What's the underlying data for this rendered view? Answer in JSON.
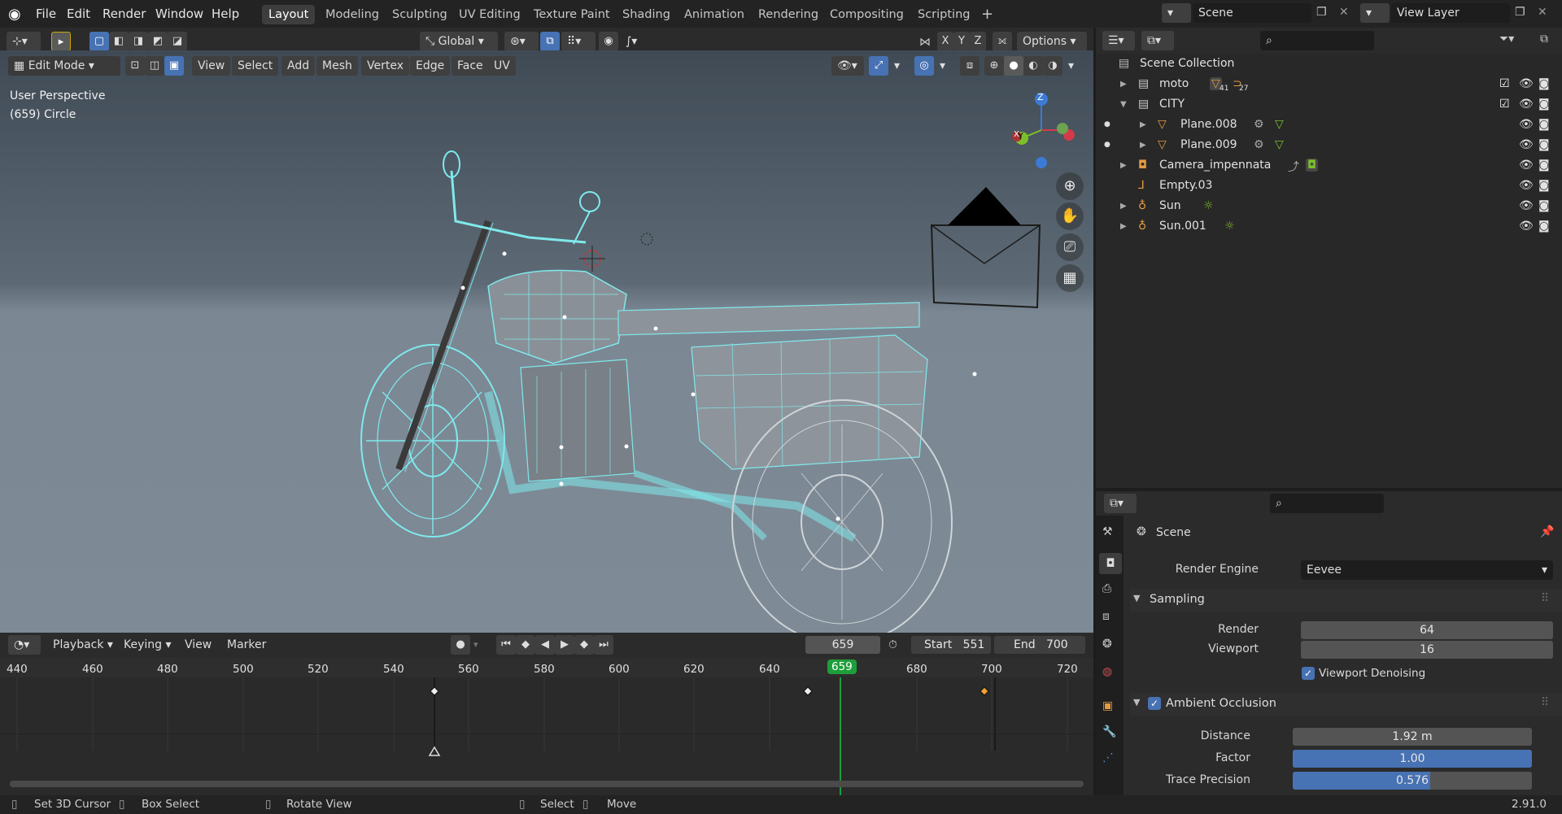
{
  "app": {
    "version": "2.91.0"
  },
  "topbar": {
    "menus": [
      "File",
      "Edit",
      "Render",
      "Window",
      "Help"
    ],
    "workspaces": [
      "Layout",
      "Modeling",
      "Sculpting",
      "UV Editing",
      "Texture Paint",
      "Shading",
      "Animation",
      "Rendering",
      "Compositing",
      "Scripting"
    ],
    "active_workspace": "Layout",
    "scene": "Scene",
    "view_layer": "View Layer"
  },
  "viewport": {
    "orientation": "Global",
    "options": "Options",
    "mode": "Edit Mode",
    "menus": [
      "View",
      "Select",
      "Add",
      "Mesh",
      "Vertex",
      "Edge",
      "Face",
      "UV"
    ],
    "axis_buttons": [
      "X",
      "Y",
      "Z"
    ],
    "overlay_title": "User Perspective",
    "overlay_object": "(659) Circle",
    "gizmo": {
      "z": "Z",
      "y": "Y",
      "x": "X"
    }
  },
  "timeline": {
    "menus": [
      "Playback",
      "Keying",
      "View",
      "Marker"
    ],
    "current_frame": "659",
    "start_label": "Start",
    "start": "551",
    "end_label": "End",
    "end": "700",
    "ticks": [
      "440",
      "460",
      "480",
      "500",
      "520",
      "540",
      "560",
      "580",
      "600",
      "620",
      "640",
      "659",
      "680",
      "700",
      "720"
    ]
  },
  "outliner": {
    "rows": [
      {
        "name": "Scene Collection"
      },
      {
        "name": "moto",
        "badge1": "41",
        "badge2": "27"
      },
      {
        "name": "CITY"
      },
      {
        "name": "Plane.008"
      },
      {
        "name": "Plane.009"
      },
      {
        "name": "Camera_impennata"
      },
      {
        "name": "Empty.03"
      },
      {
        "name": "Sun"
      },
      {
        "name": "Sun.001"
      }
    ]
  },
  "properties": {
    "context": "Scene",
    "render_engine_label": "Render Engine",
    "render_engine": "Eevee",
    "sampling": {
      "title": "Sampling",
      "render_label": "Render",
      "render": "64",
      "viewport_label": "Viewport",
      "viewport": "16",
      "denoise_label": "Viewport Denoising"
    },
    "ao": {
      "title": "Ambient Occlusion",
      "distance_label": "Distance",
      "distance": "1.92 m",
      "factor_label": "Factor",
      "factor": "1.00",
      "factor_fill": 1.0,
      "precision_label": "Trace Precision",
      "precision": "0.576",
      "precision_fill": 0.576
    }
  },
  "status": {
    "items": [
      "Set 3D Cursor",
      "Box Select",
      "Rotate View",
      "Select",
      "Move"
    ]
  },
  "colors": {
    "accent": "#4772b3",
    "wire": "#7fe9ec",
    "frame": "#1e9e3a"
  }
}
